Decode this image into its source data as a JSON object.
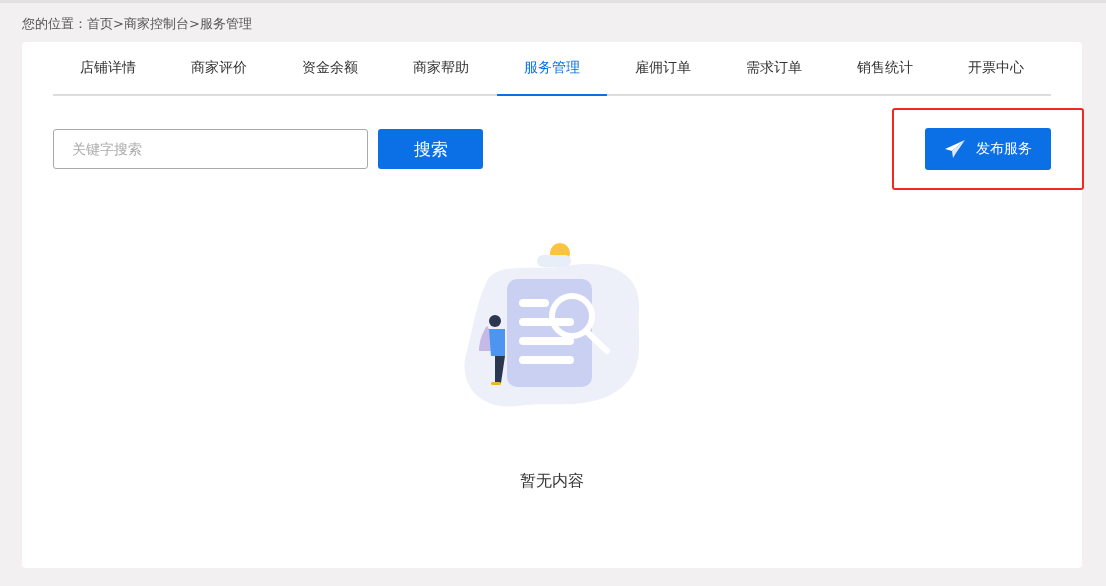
{
  "breadcrumb": "您的位置：首页>商家控制台>服务管理",
  "tabs": [
    {
      "label": "店铺详情",
      "selected": false
    },
    {
      "label": "商家评价",
      "selected": false
    },
    {
      "label": "资金余额",
      "selected": false
    },
    {
      "label": "商家帮助",
      "selected": false
    },
    {
      "label": "服务管理",
      "selected": true
    },
    {
      "label": "雇佣订单",
      "selected": false
    },
    {
      "label": "需求订单",
      "selected": false
    },
    {
      "label": "销售统计",
      "selected": false
    },
    {
      "label": "开票中心",
      "selected": false
    }
  ],
  "search": {
    "placeholder": "关键字搜索",
    "button": "搜索"
  },
  "publish_button": {
    "label": "发布服务",
    "highlighted": true
  },
  "empty_state": {
    "message": "暂无内容"
  }
}
